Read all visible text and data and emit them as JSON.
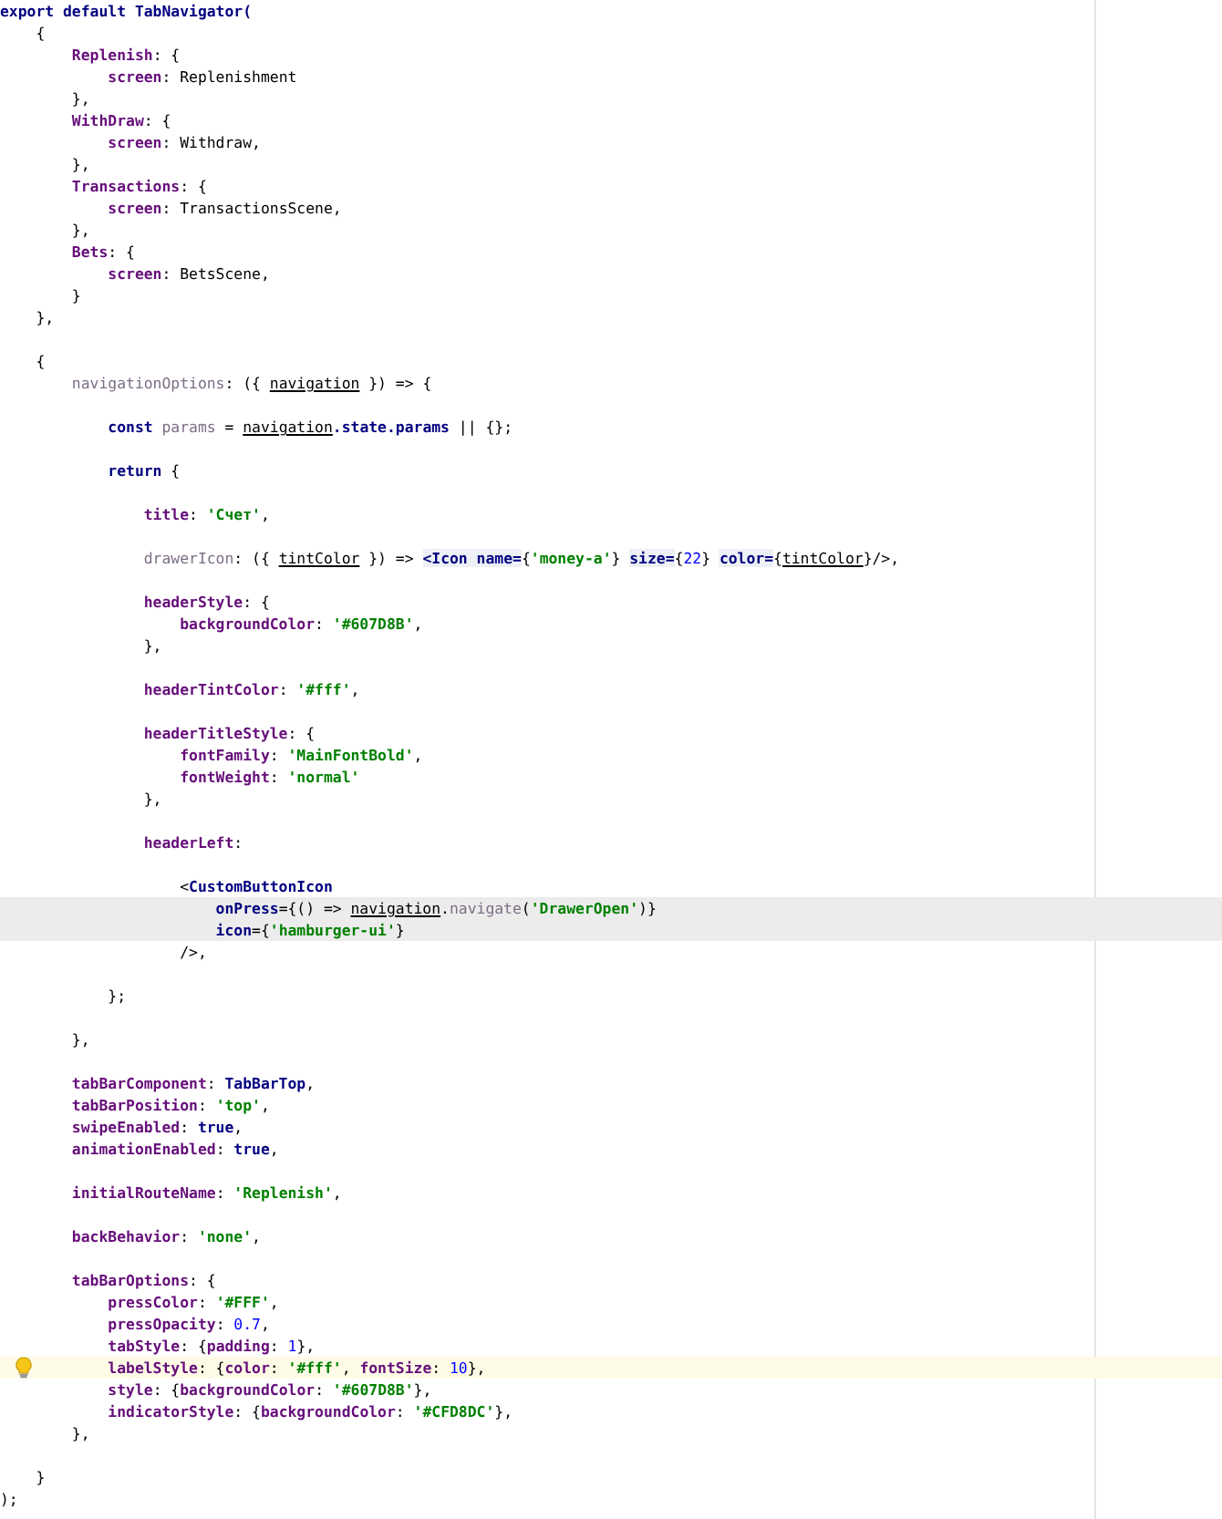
{
  "editor": {
    "lines": [
      {
        "kind": "code",
        "tokens": [
          {
            "text": "export default TabNavigator(",
            "kind": "keyword"
          }
        ]
      },
      {
        "kind": "code",
        "tokens": [
          {
            "text": "    {",
            "kind": "plain"
          }
        ]
      },
      {
        "kind": "code",
        "tokens": [
          {
            "text": "        Replenish",
            "kind": "prop"
          },
          {
            "text": ": {",
            "kind": "plain"
          }
        ]
      },
      {
        "kind": "code",
        "tokens": [
          {
            "text": "            screen",
            "kind": "prop"
          },
          {
            "text": ": Replenishment",
            "kind": "plain"
          }
        ]
      },
      {
        "kind": "code",
        "tokens": [
          {
            "text": "        },",
            "kind": "plain"
          }
        ]
      },
      {
        "kind": "code",
        "tokens": [
          {
            "text": "        WithDraw",
            "kind": "prop"
          },
          {
            "text": ": {",
            "kind": "plain"
          }
        ]
      },
      {
        "kind": "code",
        "tokens": [
          {
            "text": "            screen",
            "kind": "prop"
          },
          {
            "text": ": Withdraw,",
            "kind": "plain"
          }
        ]
      },
      {
        "kind": "code",
        "tokens": [
          {
            "text": "        },",
            "kind": "plain"
          }
        ]
      },
      {
        "kind": "code",
        "tokens": [
          {
            "text": "        Transactions",
            "kind": "prop"
          },
          {
            "text": ": {",
            "kind": "plain"
          }
        ]
      },
      {
        "kind": "code",
        "tokens": [
          {
            "text": "            screen",
            "kind": "prop"
          },
          {
            "text": ": TransactionsScene,",
            "kind": "plain"
          }
        ]
      },
      {
        "kind": "code",
        "tokens": [
          {
            "text": "        },",
            "kind": "plain"
          }
        ]
      },
      {
        "kind": "code",
        "tokens": [
          {
            "text": "        Bets",
            "kind": "prop"
          },
          {
            "text": ": {",
            "kind": "plain"
          }
        ]
      },
      {
        "kind": "code",
        "tokens": [
          {
            "text": "            screen",
            "kind": "prop"
          },
          {
            "text": ": BetsScene,",
            "kind": "plain"
          }
        ]
      },
      {
        "kind": "code",
        "tokens": [
          {
            "text": "        }",
            "kind": "plain"
          }
        ]
      },
      {
        "kind": "code",
        "tokens": [
          {
            "text": "    },",
            "kind": "plain"
          }
        ]
      },
      {
        "kind": "blank"
      },
      {
        "kind": "code",
        "tokens": [
          {
            "text": "    {",
            "kind": "plain"
          }
        ]
      },
      {
        "kind": "code",
        "tokens": [
          {
            "text": "        navigationOptions",
            "kind": "dim"
          },
          {
            "text": ": ({ ",
            "kind": "plain"
          },
          {
            "text": "navigation",
            "kind": "ref"
          },
          {
            "text": " }) => {",
            "kind": "plain"
          }
        ]
      },
      {
        "kind": "blank"
      },
      {
        "kind": "code",
        "tokens": [
          {
            "text": "            const ",
            "kind": "keyword"
          },
          {
            "text": "params",
            "kind": "dim"
          },
          {
            "text": " = ",
            "kind": "plain"
          },
          {
            "text": "navigation",
            "kind": "ref"
          },
          {
            "text": ".state.params",
            "kind": "keyword"
          },
          {
            "text": " || {};",
            "kind": "plain"
          }
        ]
      },
      {
        "kind": "blank"
      },
      {
        "kind": "code",
        "tokens": [
          {
            "text": "            return",
            "kind": "keyword"
          },
          {
            "text": " {",
            "kind": "plain"
          }
        ]
      },
      {
        "kind": "blank"
      },
      {
        "kind": "code",
        "tokens": [
          {
            "text": "                title",
            "kind": "prop"
          },
          {
            "text": ": ",
            "kind": "plain"
          },
          {
            "text": "'Счет'",
            "kind": "string"
          },
          {
            "text": ",",
            "kind": "plain"
          }
        ]
      },
      {
        "kind": "blank"
      },
      {
        "kind": "code",
        "tokens": [
          {
            "text": "                drawerIcon",
            "kind": "dim"
          },
          {
            "text": ": ({ ",
            "kind": "plain"
          },
          {
            "text": "tintColor",
            "kind": "ref"
          },
          {
            "text": " }) => ",
            "kind": "plain"
          },
          {
            "text": "<Icon name=",
            "kind": "tag"
          },
          {
            "text": "{",
            "kind": "plain"
          },
          {
            "text": "'money-a'",
            "kind": "string"
          },
          {
            "text": "} ",
            "kind": "plain"
          },
          {
            "text": "size=",
            "kind": "tag"
          },
          {
            "text": "{",
            "kind": "plain"
          },
          {
            "text": "22",
            "kind": "number"
          },
          {
            "text": "} ",
            "kind": "plain"
          },
          {
            "text": "color=",
            "kind": "tag"
          },
          {
            "text": "{",
            "kind": "plain"
          },
          {
            "text": "tintColor",
            "kind": "ref"
          },
          {
            "text": "}/>,",
            "kind": "plain"
          }
        ]
      },
      {
        "kind": "blank"
      },
      {
        "kind": "code",
        "tokens": [
          {
            "text": "                headerStyle",
            "kind": "prop"
          },
          {
            "text": ": {",
            "kind": "plain"
          }
        ]
      },
      {
        "kind": "code",
        "tokens": [
          {
            "text": "                    backgroundColor",
            "kind": "prop"
          },
          {
            "text": ": ",
            "kind": "plain"
          },
          {
            "text": "'#607D8B'",
            "kind": "string"
          },
          {
            "text": ",",
            "kind": "plain"
          }
        ]
      },
      {
        "kind": "code",
        "tokens": [
          {
            "text": "                },",
            "kind": "plain"
          }
        ]
      },
      {
        "kind": "blank"
      },
      {
        "kind": "code",
        "tokens": [
          {
            "text": "                headerTintColor",
            "kind": "prop"
          },
          {
            "text": ": ",
            "kind": "plain"
          },
          {
            "text": "'#fff'",
            "kind": "string"
          },
          {
            "text": ",",
            "kind": "plain"
          }
        ]
      },
      {
        "kind": "blank"
      },
      {
        "kind": "code",
        "tokens": [
          {
            "text": "                headerTitleStyle",
            "kind": "prop"
          },
          {
            "text": ": {",
            "kind": "plain"
          }
        ]
      },
      {
        "kind": "code",
        "tokens": [
          {
            "text": "                    fontFamily",
            "kind": "prop"
          },
          {
            "text": ": ",
            "kind": "plain"
          },
          {
            "text": "'MainFontBold'",
            "kind": "string"
          },
          {
            "text": ",",
            "kind": "plain"
          }
        ]
      },
      {
        "kind": "code",
        "tokens": [
          {
            "text": "                    fontWeight",
            "kind": "prop"
          },
          {
            "text": ": ",
            "kind": "plain"
          },
          {
            "text": "'normal'",
            "kind": "string"
          }
        ]
      },
      {
        "kind": "code",
        "tokens": [
          {
            "text": "                },",
            "kind": "plain"
          }
        ]
      },
      {
        "kind": "blank"
      },
      {
        "kind": "code",
        "tokens": [
          {
            "text": "                headerLeft",
            "kind": "prop"
          },
          {
            "text": ":",
            "kind": "plain"
          }
        ]
      },
      {
        "kind": "blank"
      },
      {
        "kind": "code",
        "tokens": [
          {
            "text": "                    <",
            "kind": "plain"
          },
          {
            "text": "CustomButtonIcon",
            "kind": "keyword"
          }
        ]
      },
      {
        "kind": "caret",
        "tokens": [
          {
            "text": "                        onPress",
            "kind": "keyword"
          },
          {
            "text": "={() => ",
            "kind": "plain"
          },
          {
            "text": "navigation",
            "kind": "ref"
          },
          {
            "text": ".",
            "kind": "plain"
          },
          {
            "text": "navigate",
            "kind": "dim"
          },
          {
            "text": "(",
            "kind": "plain"
          },
          {
            "text": "'DrawerOpen'",
            "kind": "string"
          },
          {
            "text": ")}",
            "kind": "plain"
          }
        ]
      },
      {
        "kind": "caret",
        "tokens": [
          {
            "text": "                        icon",
            "kind": "keyword"
          },
          {
            "text": "={",
            "kind": "plain"
          },
          {
            "text": "'hamburger-ui'",
            "kind": "string"
          },
          {
            "text": "}",
            "kind": "plain"
          }
        ]
      },
      {
        "kind": "code",
        "tokens": [
          {
            "text": "                    />,",
            "kind": "plain"
          }
        ]
      },
      {
        "kind": "blank"
      },
      {
        "kind": "code",
        "tokens": [
          {
            "text": "            };",
            "kind": "plain"
          }
        ]
      },
      {
        "kind": "blank"
      },
      {
        "kind": "code",
        "tokens": [
          {
            "text": "        },",
            "kind": "plain"
          }
        ]
      },
      {
        "kind": "blank"
      },
      {
        "kind": "code",
        "tokens": [
          {
            "text": "        tabBarComponent",
            "kind": "prop"
          },
          {
            "text": ": ",
            "kind": "plain"
          },
          {
            "text": "TabBarTop",
            "kind": "keyword"
          },
          {
            "text": ",",
            "kind": "plain"
          }
        ]
      },
      {
        "kind": "code",
        "tokens": [
          {
            "text": "        tabBarPosition",
            "kind": "prop"
          },
          {
            "text": ": ",
            "kind": "plain"
          },
          {
            "text": "'top'",
            "kind": "string"
          },
          {
            "text": ",",
            "kind": "plain"
          }
        ]
      },
      {
        "kind": "code",
        "tokens": [
          {
            "text": "        swipeEnabled",
            "kind": "prop"
          },
          {
            "text": ": ",
            "kind": "plain"
          },
          {
            "text": "true",
            "kind": "keyword"
          },
          {
            "text": ",",
            "kind": "plain"
          }
        ]
      },
      {
        "kind": "code",
        "tokens": [
          {
            "text": "        animationEnabled",
            "kind": "prop"
          },
          {
            "text": ": ",
            "kind": "plain"
          },
          {
            "text": "true",
            "kind": "keyword"
          },
          {
            "text": ",",
            "kind": "plain"
          }
        ]
      },
      {
        "kind": "blank"
      },
      {
        "kind": "code",
        "tokens": [
          {
            "text": "        initialRouteName",
            "kind": "prop"
          },
          {
            "text": ": ",
            "kind": "plain"
          },
          {
            "text": "'Replenish'",
            "kind": "string"
          },
          {
            "text": ",",
            "kind": "plain"
          }
        ]
      },
      {
        "kind": "blank"
      },
      {
        "kind": "code",
        "tokens": [
          {
            "text": "        backBehavior",
            "kind": "prop"
          },
          {
            "text": ": ",
            "kind": "plain"
          },
          {
            "text": "'none'",
            "kind": "string"
          },
          {
            "text": ",",
            "kind": "plain"
          }
        ]
      },
      {
        "kind": "blank"
      },
      {
        "kind": "code",
        "tokens": [
          {
            "text": "        tabBarOptions",
            "kind": "prop"
          },
          {
            "text": ": {",
            "kind": "plain"
          }
        ]
      },
      {
        "kind": "code",
        "tokens": [
          {
            "text": "            pressColor",
            "kind": "prop"
          },
          {
            "text": ": ",
            "kind": "plain"
          },
          {
            "text": "'#FFF'",
            "kind": "string"
          },
          {
            "text": ",",
            "kind": "plain"
          }
        ]
      },
      {
        "kind": "code",
        "tokens": [
          {
            "text": "            pressOpacity",
            "kind": "prop"
          },
          {
            "text": ": ",
            "kind": "plain"
          },
          {
            "text": "0.7",
            "kind": "number"
          },
          {
            "text": ",",
            "kind": "plain"
          }
        ]
      },
      {
        "kind": "code",
        "tokens": [
          {
            "text": "            tabStyle",
            "kind": "prop"
          },
          {
            "text": ": {",
            "kind": "plain"
          },
          {
            "text": "padding",
            "kind": "prop"
          },
          {
            "text": ": ",
            "kind": "plain"
          },
          {
            "text": "1",
            "kind": "number"
          },
          {
            "text": "},",
            "kind": "plain"
          }
        ]
      },
      {
        "kind": "hint",
        "tokens": [
          {
            "text": "            labelStyle",
            "kind": "prop"
          },
          {
            "text": ": {",
            "kind": "plain"
          },
          {
            "text": "color",
            "kind": "prop"
          },
          {
            "text": ": ",
            "kind": "plain"
          },
          {
            "text": "'#fff'",
            "kind": "string"
          },
          {
            "text": ", ",
            "kind": "plain"
          },
          {
            "text": "fontSize",
            "kind": "prop"
          },
          {
            "text": ": ",
            "kind": "plain"
          },
          {
            "text": "10",
            "kind": "number"
          },
          {
            "text": "},",
            "kind": "plain"
          }
        ]
      },
      {
        "kind": "code",
        "tokens": [
          {
            "text": "            style",
            "kind": "prop"
          },
          {
            "text": ": {",
            "kind": "plain"
          },
          {
            "text": "backgroundColor",
            "kind": "prop"
          },
          {
            "text": ": ",
            "kind": "plain"
          },
          {
            "text": "'#607D8B'",
            "kind": "string"
          },
          {
            "text": "},",
            "kind": "plain"
          }
        ]
      },
      {
        "kind": "code",
        "tokens": [
          {
            "text": "            indicatorStyle",
            "kind": "prop"
          },
          {
            "text": ": {",
            "kind": "plain"
          },
          {
            "text": "backgroundColor",
            "kind": "prop"
          },
          {
            "text": ": ",
            "kind": "plain"
          },
          {
            "text": "'#CFD8DC'",
            "kind": "string"
          },
          {
            "text": "},",
            "kind": "plain"
          }
        ]
      },
      {
        "kind": "code",
        "tokens": [
          {
            "text": "        },",
            "kind": "plain"
          }
        ]
      },
      {
        "kind": "blank"
      },
      {
        "kind": "code",
        "tokens": [
          {
            "text": "    }",
            "kind": "plain"
          }
        ]
      },
      {
        "kind": "code",
        "tokens": [
          {
            "text": ");",
            "kind": "plain"
          }
        ]
      }
    ]
  }
}
